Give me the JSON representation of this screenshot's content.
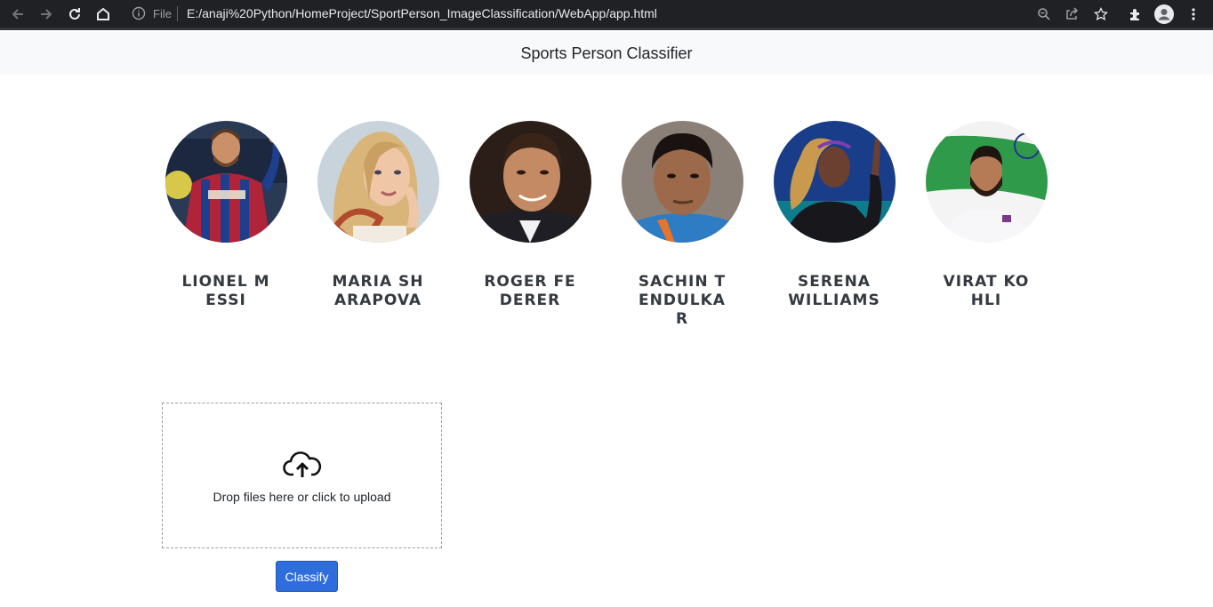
{
  "browser": {
    "scheme_label": "File",
    "url": "E:/anaji%20Python/HomeProject/SportPerson_ImageClassification/WebApp/app.html"
  },
  "header": {
    "title": "Sports Person Classifier"
  },
  "players": [
    {
      "name": "LIONEL MESSI"
    },
    {
      "name": "MARIA SHARAPOVA"
    },
    {
      "name": "ROGER FEDERER"
    },
    {
      "name": "SACHIN TENDULKAR"
    },
    {
      "name": "SERENA WILLIAMS"
    },
    {
      "name": "VIRAT KOHLI"
    }
  ],
  "dropzone": {
    "message": "Drop files here or click to upload",
    "icon": "cloud-upload-icon"
  },
  "actions": {
    "classify_label": "Classify"
  },
  "colors": {
    "primary_button": "#2f6ddd",
    "header_bg": "#f8f9fa",
    "chrome_bg": "#202124"
  }
}
